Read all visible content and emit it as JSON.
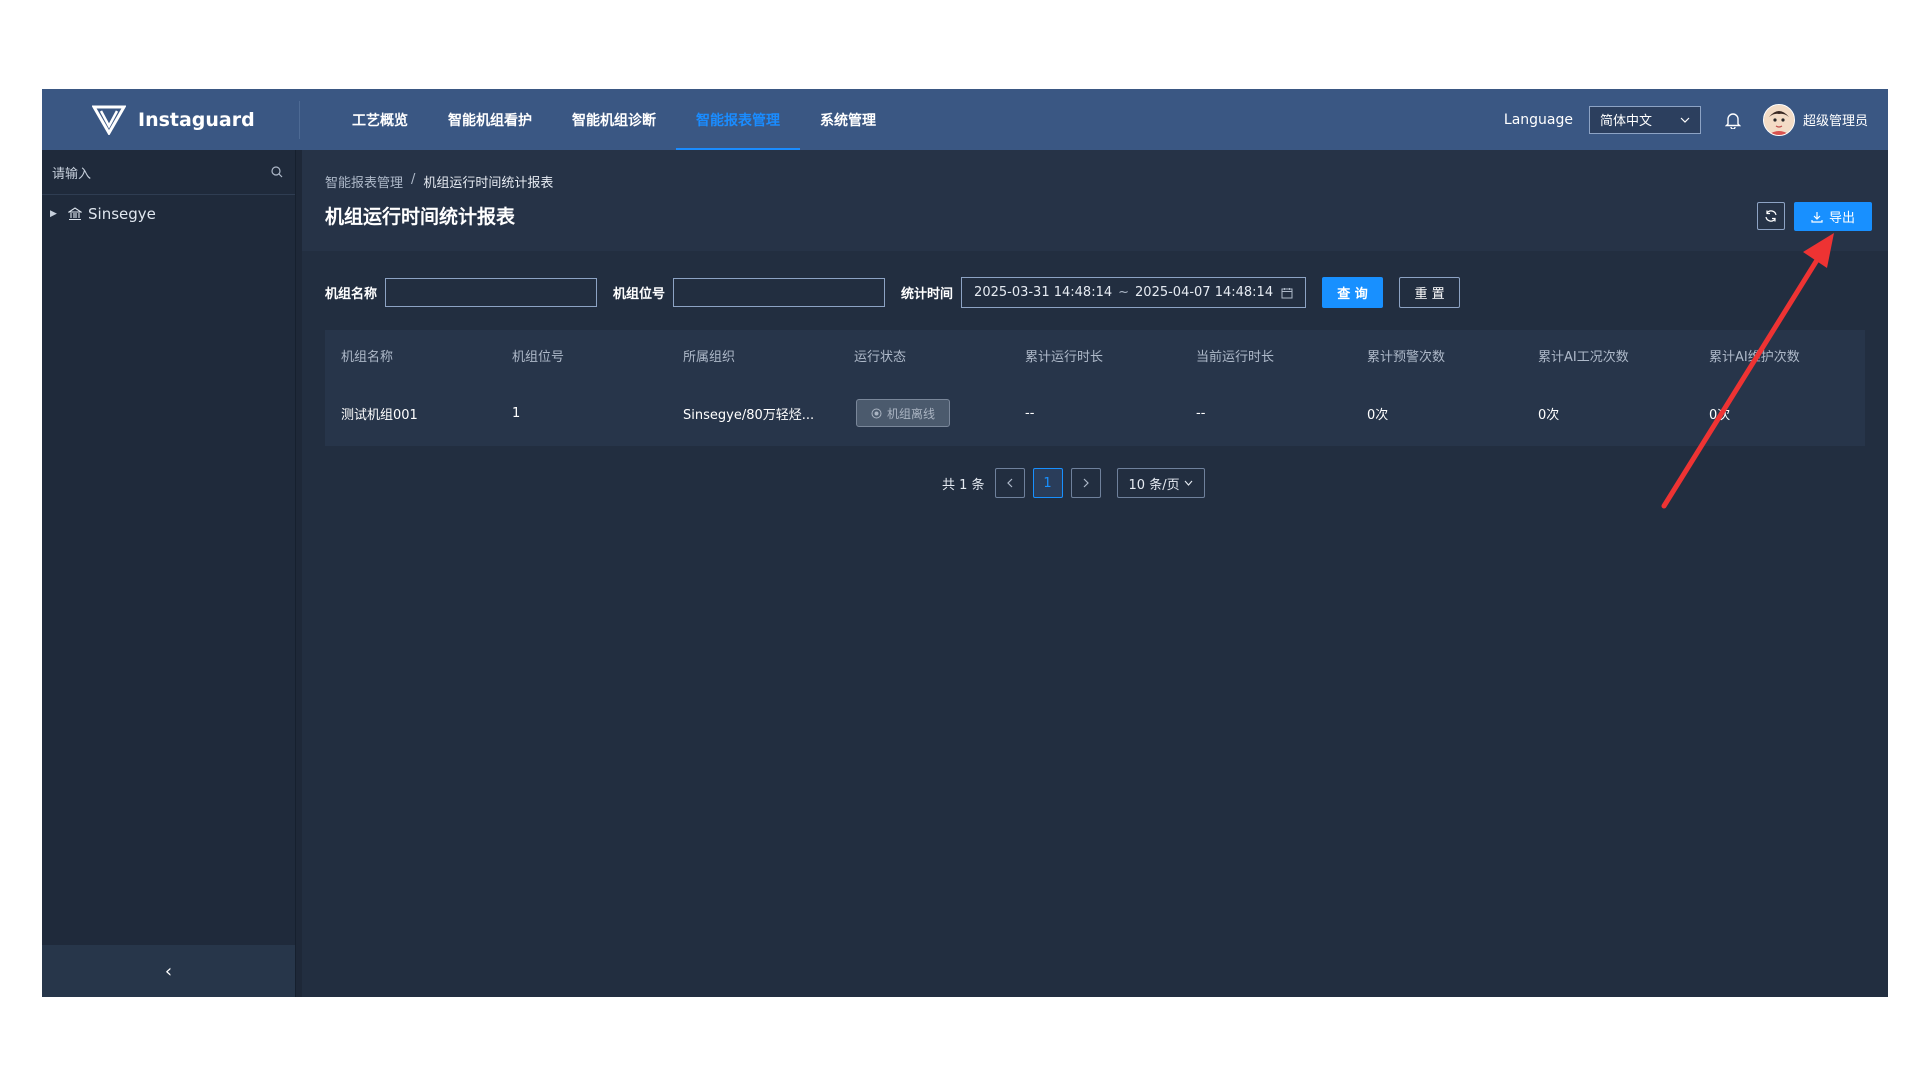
{
  "app": {
    "brand": "Instaguard",
    "nav": [
      {
        "label": "工艺概览",
        "active": false
      },
      {
        "label": "智能机组看护",
        "active": false
      },
      {
        "label": "智能机组诊断",
        "active": false
      },
      {
        "label": "智能报表管理",
        "active": true
      },
      {
        "label": "系统管理",
        "active": false
      }
    ],
    "language_label": "Language",
    "language_value": "简体中文",
    "user_name": "超级管理员",
    "accent_color": "#1890ff",
    "topbar_color": "#3a5783"
  },
  "sidebar": {
    "search_placeholder": "请输入",
    "tree": [
      {
        "label": "Sinsegye",
        "icon": "bank-icon"
      }
    ],
    "collapse_glyph": "‹"
  },
  "page": {
    "breadcrumb": [
      "智能报表管理",
      "/",
      "机组运行时间统计报表"
    ],
    "title": "机组运行时间统计报表",
    "export_label": "导出"
  },
  "filters": {
    "unit_name_label": "机组名称",
    "unit_position_label": "机组位号",
    "time_label": "统计时间",
    "date_start": "2025-03-31 14:48:14",
    "date_sep": "~",
    "date_end": "2025-04-07 14:48:14",
    "query_label": "查 询",
    "reset_label": "重 置"
  },
  "table": {
    "columns": [
      "机组名称",
      "机组位号",
      "所属组织",
      "运行状态",
      "累计运行时长",
      "当前运行时长",
      "累计预警次数",
      "累计AI工况次数",
      "累计AI维护次数"
    ],
    "rows": [
      {
        "name": "测试机组001",
        "position": "1",
        "org": "Sinsegye/80万轻烃...",
        "status": "机组离线",
        "total_runtime": "--",
        "current_runtime": "--",
        "alerts": "0次",
        "ai_conditions": "0次",
        "ai_maintenance": "0次"
      }
    ]
  },
  "pagination": {
    "total": "共 1 条",
    "current_page": "1",
    "page_size": "10 条/页"
  },
  "annotation": {
    "color": "#ee3333"
  }
}
